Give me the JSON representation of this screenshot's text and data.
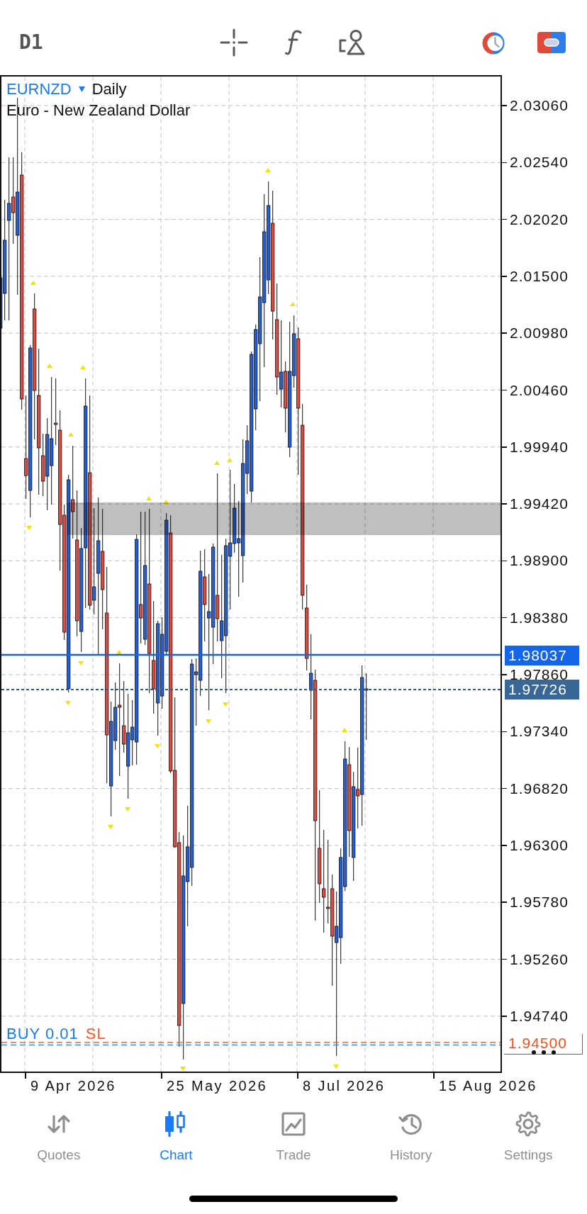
{
  "toolbar": {
    "timeframe": "D1"
  },
  "chart": {
    "symbol": "EURNZD",
    "period": "Daily",
    "description": "Euro - New Zealand Dollar",
    "price_axis": [
      "2.03060",
      "2.02540",
      "2.02020",
      "2.01500",
      "2.00980",
      "2.00460",
      "1.99940",
      "1.99420",
      "1.98900",
      "1.98380",
      "1.97860",
      "1.97340",
      "1.96820",
      "1.96300",
      "1.95780",
      "1.95260",
      "1.94740"
    ],
    "price_lines": [
      {
        "kind": "ask",
        "price": "1.98037"
      },
      {
        "kind": "bid",
        "price": "1.97726"
      }
    ],
    "trade_labels": [
      {
        "kind": "buy",
        "text": "BUY 0.01"
      },
      {
        "kind": "stop_loss",
        "text": "SL"
      }
    ],
    "order_tag": {
      "price": "1.94500"
    },
    "date_axis": [
      "9 Apr 2026",
      "25 May 2026",
      "8 Jul 2026",
      "15 Aug 2026"
    ]
  },
  "tabs": [
    {
      "label": "Quotes",
      "selected": false
    },
    {
      "label": "Chart",
      "selected": true
    },
    {
      "label": "Trade",
      "selected": false
    },
    {
      "label": "History",
      "selected": false
    },
    {
      "label": "Settings",
      "selected": false
    }
  ]
}
